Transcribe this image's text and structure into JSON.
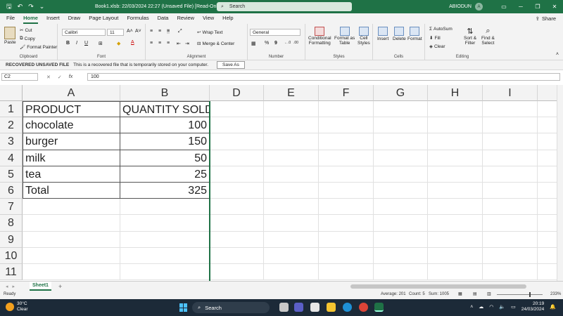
{
  "titlebar": {
    "title": "Book1.xlsb: 22/03/2024 22:27 (Unsaved File) [Read-Only] - Excel",
    "search_placeholder": "Search",
    "user_name": "ABIODUN",
    "avatar_letter": "A"
  },
  "menu": {
    "tabs": [
      "File",
      "Home",
      "Insert",
      "Draw",
      "Page Layout",
      "Formulas",
      "Data",
      "Review",
      "View",
      "Help"
    ],
    "active": "Home",
    "share_label": "Share"
  },
  "ribbon": {
    "clipboard": {
      "label": "Clipboard",
      "paste": "Paste",
      "cut": "Cut",
      "copy": "Copy",
      "format_painter": "Format Painter"
    },
    "font": {
      "label": "Font",
      "font_name": "Calibri",
      "font_size": "11",
      "bold": "B",
      "italic": "I",
      "underline": "U"
    },
    "alignment": {
      "label": "Alignment",
      "wrap_text": "Wrap Text",
      "merge_center": "Merge & Center"
    },
    "number": {
      "label": "Number",
      "format": "General",
      "percent": "%",
      "comma": "9"
    },
    "styles": {
      "label": "Styles",
      "conditional": "Conditional",
      "conditional2": "Formatting",
      "format_as": "Format as",
      "format_as2": "Table",
      "cell": "Cell",
      "cell2": "Styles"
    },
    "cells": {
      "label": "Cells",
      "insert": "Insert",
      "delete": "Delete",
      "format": "Format"
    },
    "editing": {
      "label": "Editing",
      "autosum": "AutoSum",
      "fill": "Fill",
      "clear": "Clear",
      "sort": "Sort &",
      "sort2": "Filter",
      "find": "Find &",
      "find2": "Select"
    }
  },
  "infobar": {
    "title": "RECOVERED UNSAVED FILE",
    "message": "This is a recovered file that is temporarily stored on your computer.",
    "button": "Save As"
  },
  "formula_bar": {
    "name_box": "C2",
    "fx": "fx",
    "value": "100"
  },
  "grid": {
    "columns": [
      "A",
      "B",
      "D",
      "E",
      "F",
      "G",
      "H",
      "I"
    ],
    "rows": [
      "1",
      "2",
      "3",
      "4",
      "5",
      "6",
      "7",
      "8",
      "9",
      "10",
      "11"
    ],
    "cells": [
      [
        "PRODUCT",
        "QUANTITY SOLD"
      ],
      [
        "chocolate",
        "100"
      ],
      [
        "burger",
        "150"
      ],
      [
        "milk",
        "50"
      ],
      [
        "tea",
        "25"
      ],
      [
        "Total",
        "325"
      ]
    ]
  },
  "sheets": {
    "tabs": [
      "Sheet1"
    ],
    "add": "+"
  },
  "status": {
    "ready": "Ready",
    "average": "Average: 201",
    "count": "Count: 5",
    "sum": "Sum: 1005",
    "zoom": "233%"
  },
  "taskbar": {
    "temp": "30°C",
    "weather": "Clear",
    "search": "Search",
    "time": "20:19",
    "date": "24/03/2024"
  },
  "colors": {
    "excel_green": "#1f7246",
    "taskbar": "#1c2a38"
  }
}
